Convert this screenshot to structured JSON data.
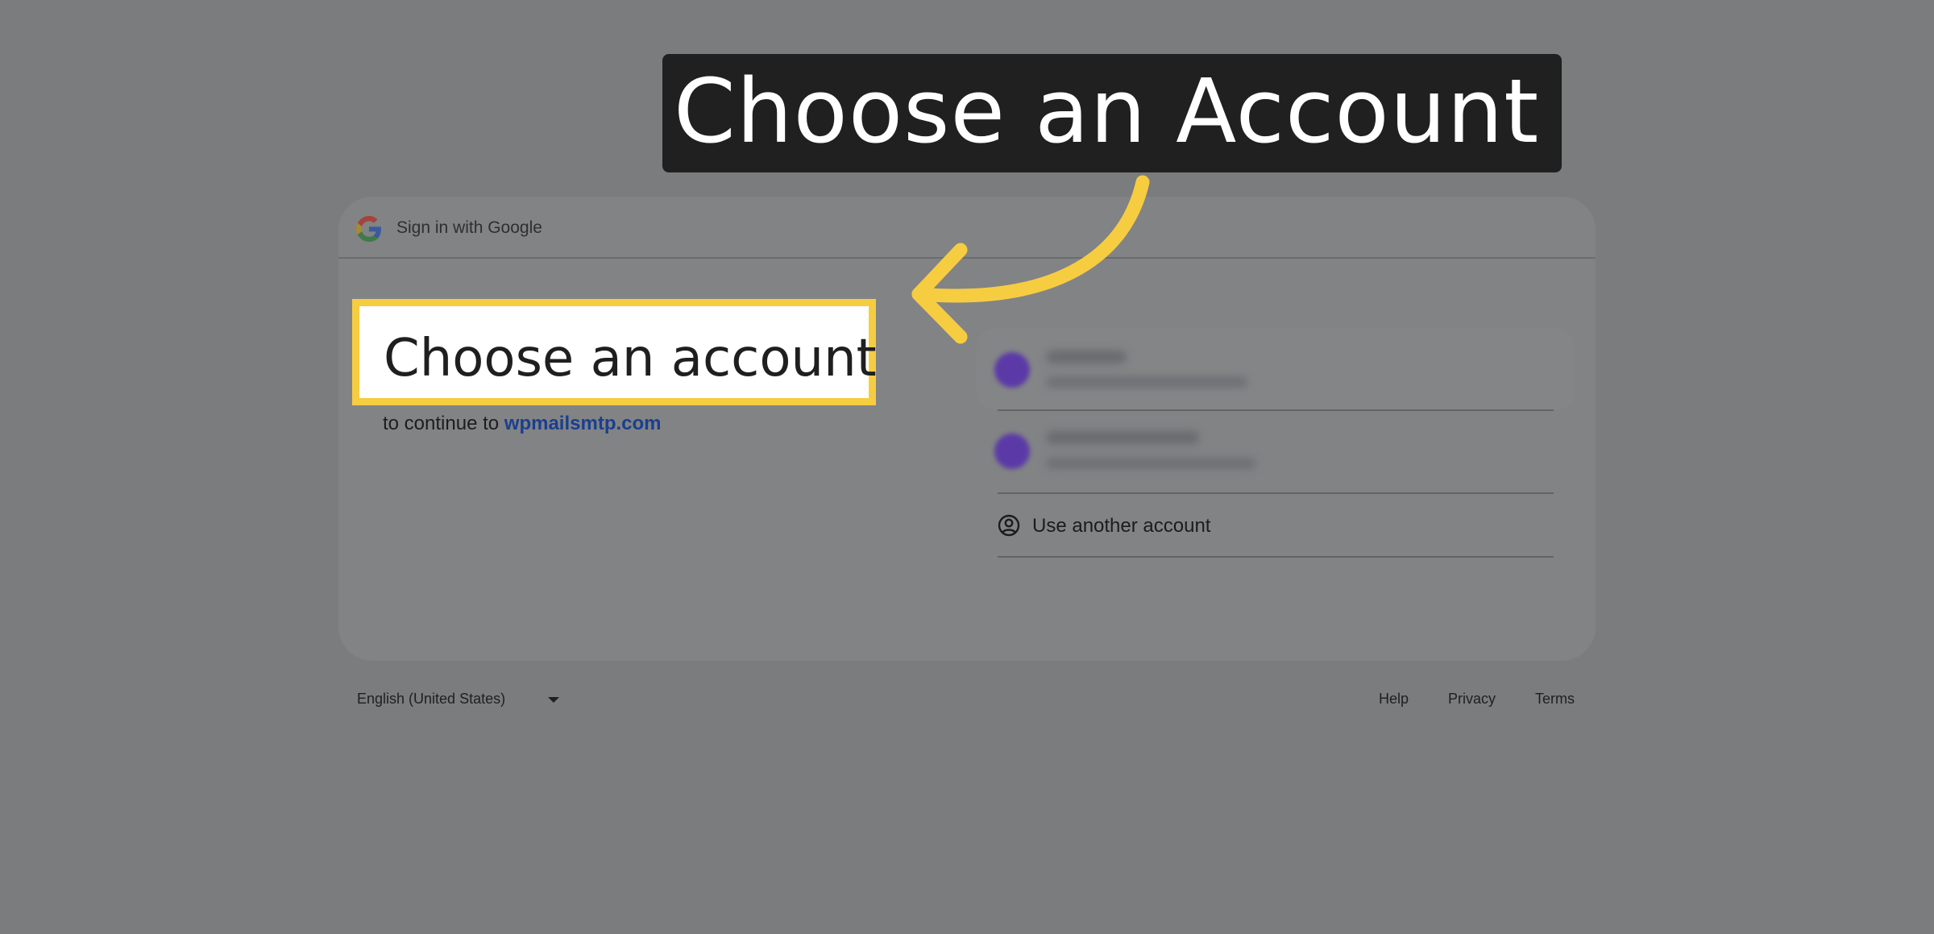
{
  "callout": {
    "title": "Choose an Account"
  },
  "card": {
    "header_title": "Sign in with Google",
    "heading": "Choose an account",
    "subtitle_prefix": "to continue to",
    "subtitle_domain": "wpmailsmtp.com"
  },
  "accounts": {
    "use_another_label": "Use another account"
  },
  "footer": {
    "language": "English (United States)",
    "help": "Help",
    "privacy": "Privacy",
    "terms": "Terms"
  },
  "colors": {
    "highlight": "#f6cd41",
    "callout_bg": "#202020",
    "link": "#1a3f8f",
    "avatar": "#5b3aa8"
  },
  "icons": {
    "logo": "google-g-icon",
    "use_another": "user-circle-icon",
    "language_dropdown": "caret-down-icon",
    "annotation_arrow": "curved-arrow-icon"
  }
}
